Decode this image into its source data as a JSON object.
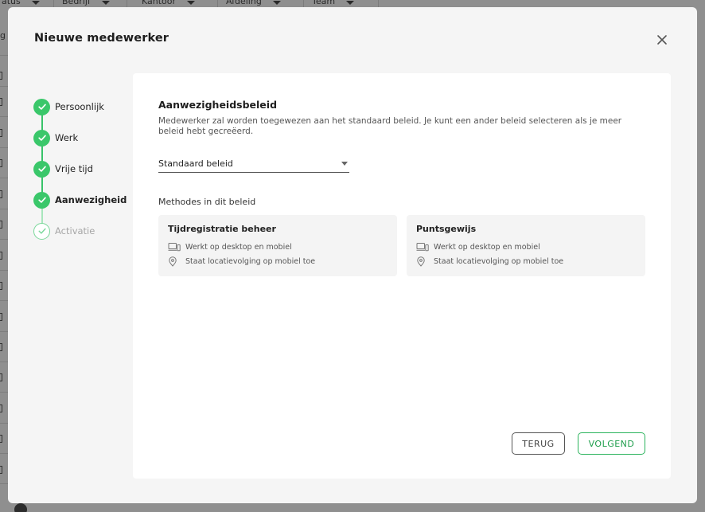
{
  "background": {
    "filters": [
      {
        "label": "atus",
        "icon": "caret-down-icon"
      },
      {
        "label": "Bedrijf",
        "icon": "caret-down-icon"
      },
      {
        "label": "Kantoor",
        "icon": "caret-down-icon"
      },
      {
        "label": "Afdeling",
        "icon": "caret-down-icon"
      },
      {
        "label": "Team",
        "icon": "caret-down-icon"
      }
    ],
    "left_text": "g"
  },
  "modal": {
    "title": "Nieuwe medewerker",
    "close_icon": "close-icon"
  },
  "steps": [
    {
      "label": "Persoonlijk",
      "status": "done"
    },
    {
      "label": "Werk",
      "status": "done"
    },
    {
      "label": "Vrije tijd",
      "status": "done"
    },
    {
      "label": "Aanwezigheid",
      "status": "current"
    },
    {
      "label": "Activatie",
      "status": "pending"
    }
  ],
  "policy": {
    "title": "Aanwezigheidsbeleid",
    "description": "Medewerker zal worden toegewezen aan het standaard beleid. Je kunt een ander beleid selecteren als je meer beleid hebt gecreëerd.",
    "selected": "Standaard beleid",
    "methods_heading": "Methodes in dit beleid"
  },
  "methods": [
    {
      "title": "Tijdregistratie beheer",
      "device_text": "Werkt op desktop en mobiel",
      "location_text": "Staat locatievolging op mobiel toe"
    },
    {
      "title": "Puntsgewijs",
      "device_text": "Werkt op desktop en mobiel",
      "location_text": "Staat locatievolging op mobiel toe"
    }
  ],
  "buttons": {
    "back": "TERUG",
    "next": "VOLGEND"
  },
  "colors": {
    "accent_green": "#3ac76a",
    "overlay": "#8f8f8f",
    "card": "#ffffff"
  }
}
